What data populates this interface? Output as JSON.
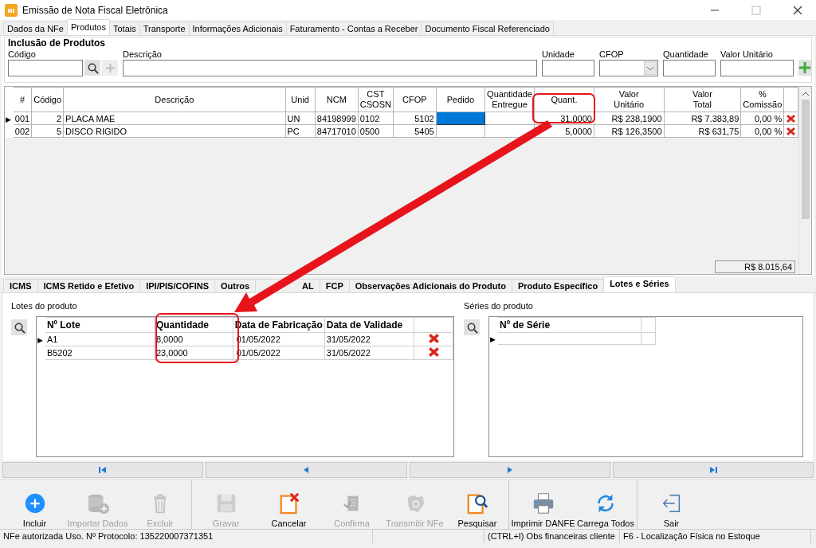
{
  "window": {
    "title": "Emissão de Nota Fiscal Eletrônica"
  },
  "tabs": [
    {
      "label": "Dados da NFe",
      "selected": false
    },
    {
      "label": "Produtos",
      "selected": true
    },
    {
      "label": "Totais",
      "selected": false
    },
    {
      "label": "Transporte",
      "selected": false
    },
    {
      "label": "Informações Adicionais",
      "selected": false
    },
    {
      "label": "Faturamento - Contas a Receber",
      "selected": false
    },
    {
      "label": "Documento Fiscal Referenciado",
      "selected": false
    }
  ],
  "inclusion": {
    "title": "Inclusão de Produtos",
    "fields": [
      {
        "label": "Código",
        "kind": "lookup"
      },
      {
        "label": "Descrição",
        "kind": "wide"
      },
      {
        "label": "Unidade",
        "kind": "text"
      },
      {
        "label": "CFOP",
        "kind": "combo"
      },
      {
        "label": "Quantidade",
        "kind": "text"
      },
      {
        "label": "Valor Unitário",
        "kind": "text"
      }
    ]
  },
  "products": {
    "columns": [
      "#",
      "Código",
      "Descrição",
      "Unid",
      "NCM",
      "CST\nCSOSN",
      "CFOP",
      "Pedido",
      "Quantidade\nEntregue",
      "Quant.",
      "Valor\nUnitário",
      "Valor\nTotal",
      "%\nComissão"
    ],
    "rows": [
      {
        "selected": true,
        "pedido_focused": true,
        "cells": [
          "001",
          "2",
          "PLACA MAE",
          "UN",
          "84198999",
          "0102",
          "5102",
          "",
          "",
          "31,0000",
          "R$ 238,1900",
          "R$ 7.383,89",
          "0,00 %"
        ]
      },
      {
        "selected": false,
        "pedido_focused": false,
        "cells": [
          "002",
          "5",
          "DISCO RIGIDO",
          "PC",
          "84717010",
          "0500",
          "5405",
          "",
          "",
          "5,0000",
          "R$ 126,3500",
          "R$ 631,75",
          "0,00 %"
        ]
      }
    ],
    "row_marker": "▶",
    "total": "R$ 8.015,64"
  },
  "detail_tabs": [
    {
      "label": "ICMS",
      "selected": false
    },
    {
      "label": "ICMS Retido e Efetivo",
      "selected": false
    },
    {
      "label": "IPI/PIS/COFINS",
      "selected": false
    },
    {
      "label": "Outros",
      "selected": false
    },
    {
      "label": "AL",
      "selected": false
    },
    {
      "label": "FCP",
      "selected": false
    },
    {
      "label": "Observações Adicionais do Produto",
      "selected": false
    },
    {
      "label": "Produto Específico",
      "selected": false
    },
    {
      "label": "Lotes e Séries",
      "selected": true
    }
  ],
  "lotes": {
    "title": "Lotes do produto",
    "columns": [
      "Nº Lote",
      "Quantidade",
      "Data de Fabricação",
      "Data de Validade"
    ],
    "row_marker": "▶",
    "rows": [
      {
        "selected": true,
        "cells": [
          "A1",
          "8,0000",
          "01/05/2022",
          "31/05/2022"
        ]
      },
      {
        "selected": false,
        "cells": [
          "B5202",
          "23,0000",
          "01/05/2022",
          "31/05/2022"
        ]
      }
    ]
  },
  "series": {
    "title": "Séries do produto",
    "columns": [
      "Nº de Série"
    ],
    "row_marker": "▶",
    "rows": [
      {
        "selected": true
      }
    ]
  },
  "navigation": [
    {
      "kind": "first"
    },
    {
      "kind": "prev"
    },
    {
      "kind": "next"
    },
    {
      "kind": "last"
    }
  ],
  "toolbar": [
    {
      "label": "Incluir",
      "kind": "add",
      "disabled": false,
      "group_end": false
    },
    {
      "label": "Importar Dados",
      "kind": "database",
      "disabled": true,
      "group_end": false
    },
    {
      "label": "Excluir",
      "kind": "trash",
      "disabled": true,
      "group_end": true
    },
    {
      "label": "Gravar",
      "kind": "save",
      "disabled": true,
      "group_end": false
    },
    {
      "label": "Cancelar",
      "kind": "cancel",
      "disabled": false,
      "group_end": false
    },
    {
      "label": "Confirma",
      "kind": "confirm",
      "disabled": true,
      "group_end": false
    },
    {
      "label": "Transmitir NFe",
      "kind": "map",
      "disabled": true,
      "group_end": false
    },
    {
      "label": "Pesquisar",
      "kind": "search",
      "disabled": false,
      "group_end": true
    },
    {
      "label": "Imprimir DANFE",
      "kind": "print",
      "disabled": false,
      "group_end": false
    },
    {
      "label": "Carrega Todos",
      "kind": "refresh",
      "disabled": false,
      "group_end": true
    },
    {
      "label": "Sair",
      "kind": "exit",
      "disabled": false,
      "group_end": false
    }
  ],
  "status_bar": [
    "NFe autorizada Uso. Nº Protocolo: 135220007371351",
    "(CTRL+I) Obs financeiras cliente",
    "F6 - Localização Física no Estoque"
  ]
}
